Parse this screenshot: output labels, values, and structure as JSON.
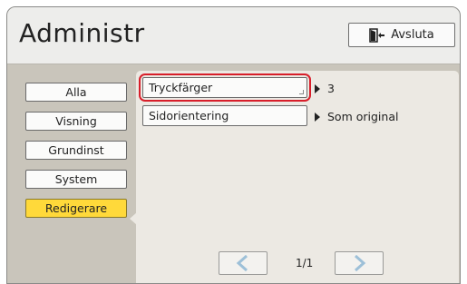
{
  "header": {
    "title": "Administr",
    "exit_label": "Avsluta"
  },
  "nav": {
    "items": [
      {
        "label": "Alla",
        "active": false
      },
      {
        "label": "Visning",
        "active": false
      },
      {
        "label": "Grundinst",
        "active": false
      },
      {
        "label": "System",
        "active": false
      },
      {
        "label": "Redigerare",
        "active": true
      }
    ]
  },
  "settings": [
    {
      "label": "Tryckfärger",
      "value": "3",
      "highlighted": true
    },
    {
      "label": "Sidorientering",
      "value": "Som original",
      "highlighted": false
    }
  ],
  "pagination": {
    "indicator": "1/1"
  },
  "colors": {
    "accent_active": "#ffd93a",
    "highlight": "#d81e2a",
    "arrow": "#9dc0d8"
  }
}
